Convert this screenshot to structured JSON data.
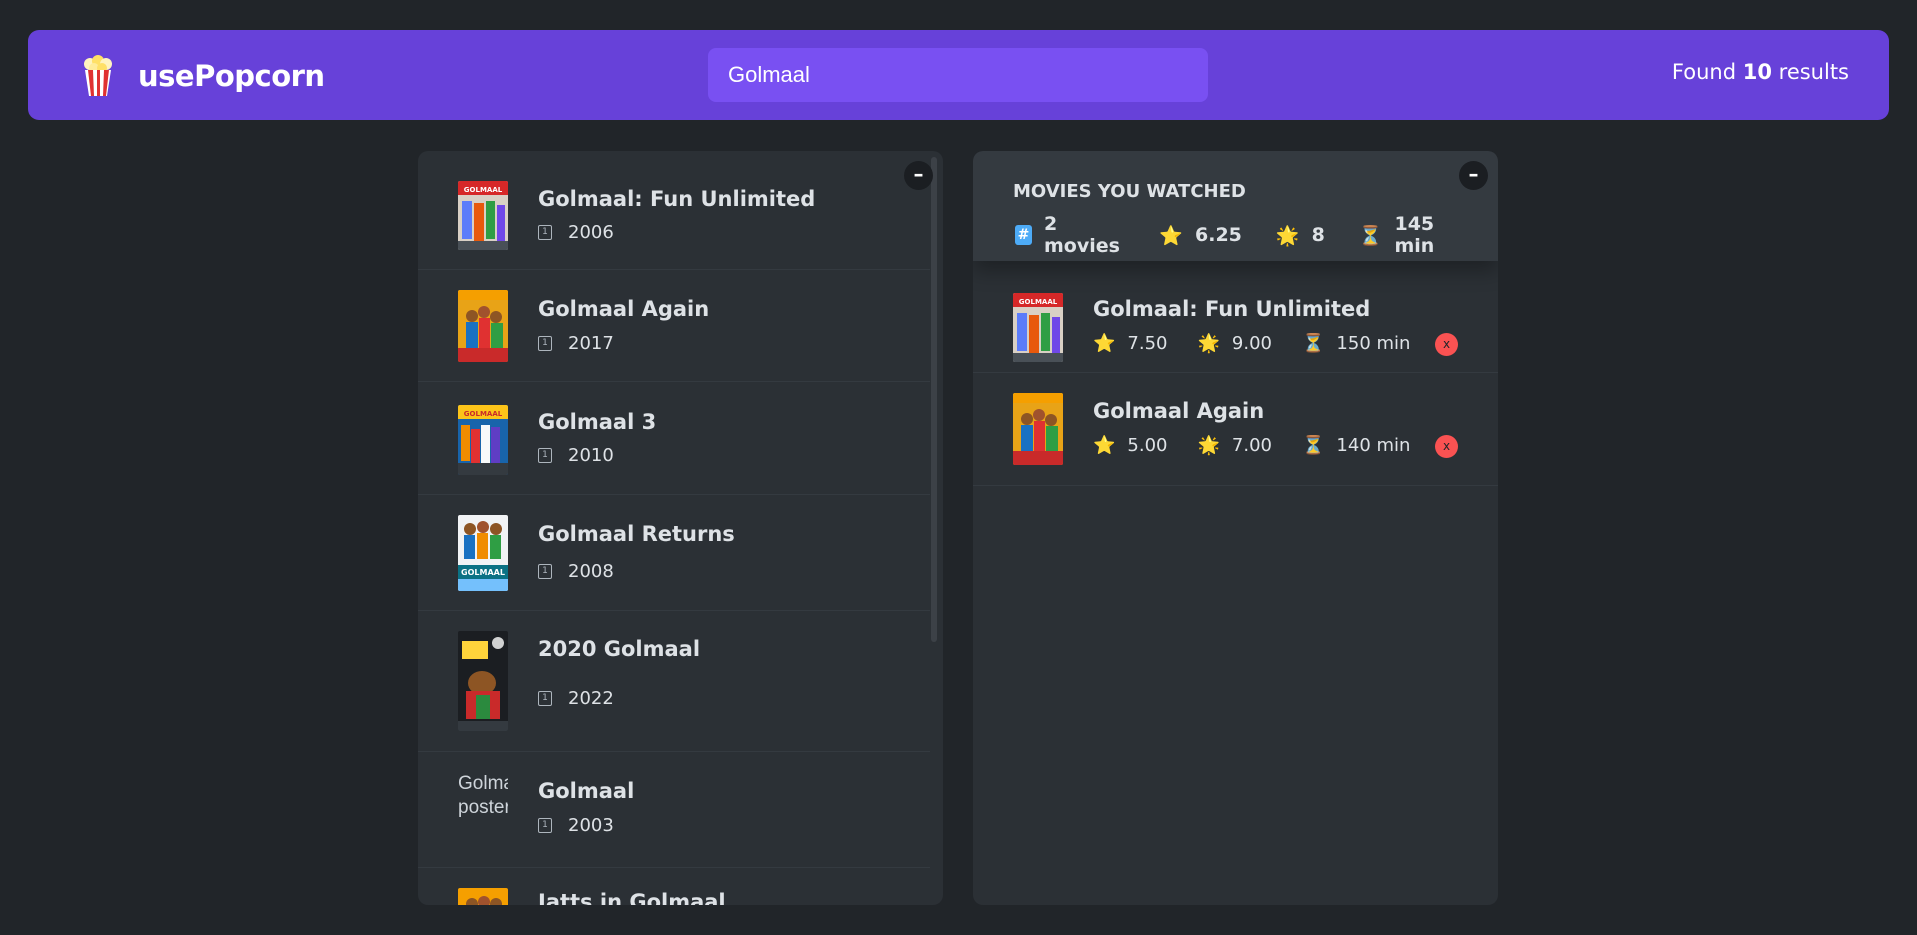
{
  "nav": {
    "logo_text": "usePopcorn",
    "search_value": "Golmaal",
    "results_prefix": "Found",
    "results_count": "10",
    "results_suffix": "results"
  },
  "list_box": {
    "toggle": "–",
    "movies": [
      {
        "title": "Golmaal: Fun Unlimited",
        "year": "2006"
      },
      {
        "title": "Golmaal Again",
        "year": "2017"
      },
      {
        "title": "Golmaal 3",
        "year": "2010"
      },
      {
        "title": "Golmaal Returns",
        "year": "2008"
      },
      {
        "title": "2020 Golmaal",
        "year": "2022"
      },
      {
        "title": "Golmaal",
        "year": "2003",
        "poster_alt": "Golmaal poster"
      },
      {
        "title": "Jatts in Golmaal",
        "year": ""
      }
    ]
  },
  "watched_box": {
    "toggle": "–",
    "heading": "MOVIES YOU WATCHED",
    "summary": {
      "count": "2 movies",
      "imdb_rating": "6.25",
      "user_rating": "8",
      "runtime": "145 min"
    },
    "movies": [
      {
        "title": "Golmaal: Fun Unlimited",
        "imdb_rating": "7.50",
        "user_rating": "9.00",
        "runtime": "150 min",
        "delete": "x"
      },
      {
        "title": "Golmaal Again",
        "imdb_rating": "5.00",
        "user_rating": "7.00",
        "runtime": "140 min",
        "delete": "x"
      }
    ]
  },
  "icons": {
    "hash": "#",
    "star": "⭐",
    "sun": "🌟",
    "hourglass": "⏳",
    "calendar": "1"
  }
}
